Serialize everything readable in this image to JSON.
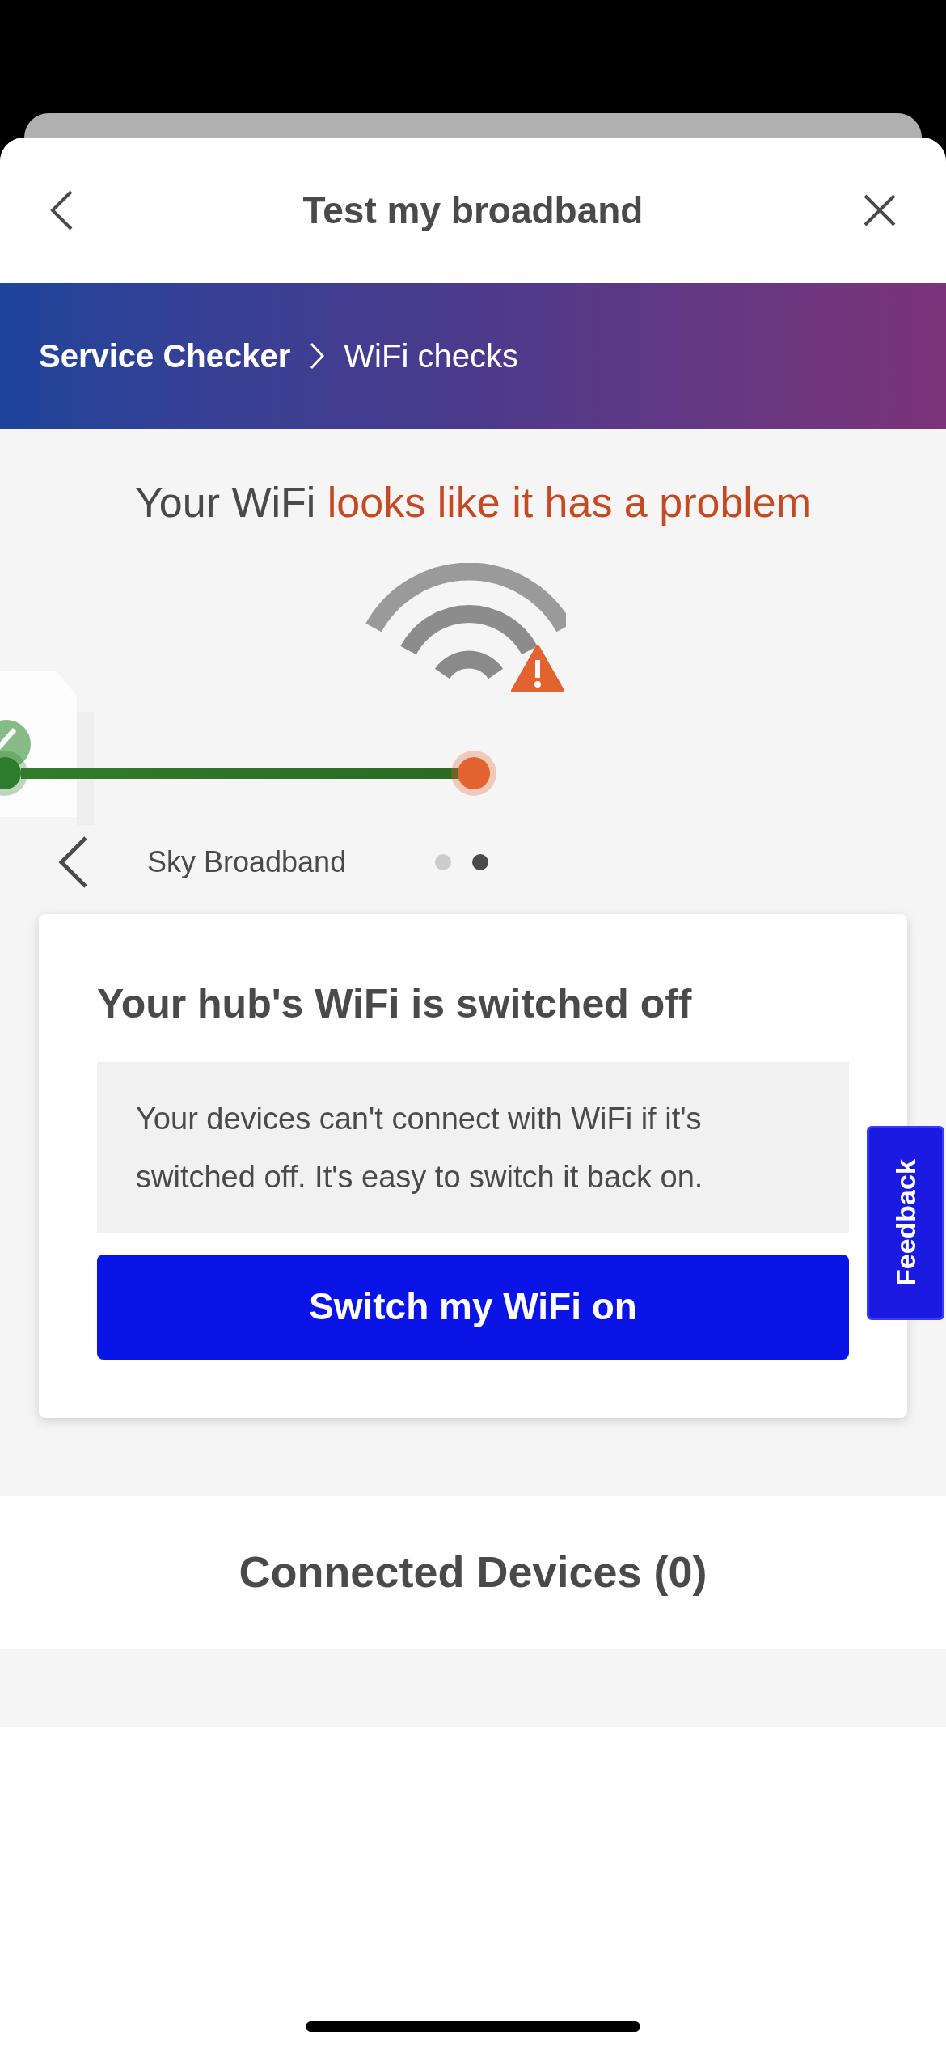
{
  "header": {
    "title": "Test my broadband"
  },
  "breadcrumb": [
    {
      "label": "Service Checker",
      "current": false
    },
    {
      "label": "WiFi checks",
      "current": true
    }
  ],
  "headline": {
    "text": "Your WiFi",
    "highlight": "looks like it has a problem"
  },
  "route": {
    "stops": [
      {
        "kind": "ok"
      },
      {
        "kind": "warning"
      }
    ]
  },
  "carousel": {
    "label": "Sky Broadband",
    "dots": [
      {
        "selected": false
      },
      {
        "selected": true
      }
    ]
  },
  "card": {
    "title": "Your hub's WiFi is switched off",
    "message": "Your devices can't connect with WiFi if it's switched off. It's easy to switch it back on.",
    "button": "Switch my WiFi on"
  },
  "feedback": {
    "label": "Feedback"
  },
  "devices": {
    "label": "Connected Devices (0)"
  }
}
